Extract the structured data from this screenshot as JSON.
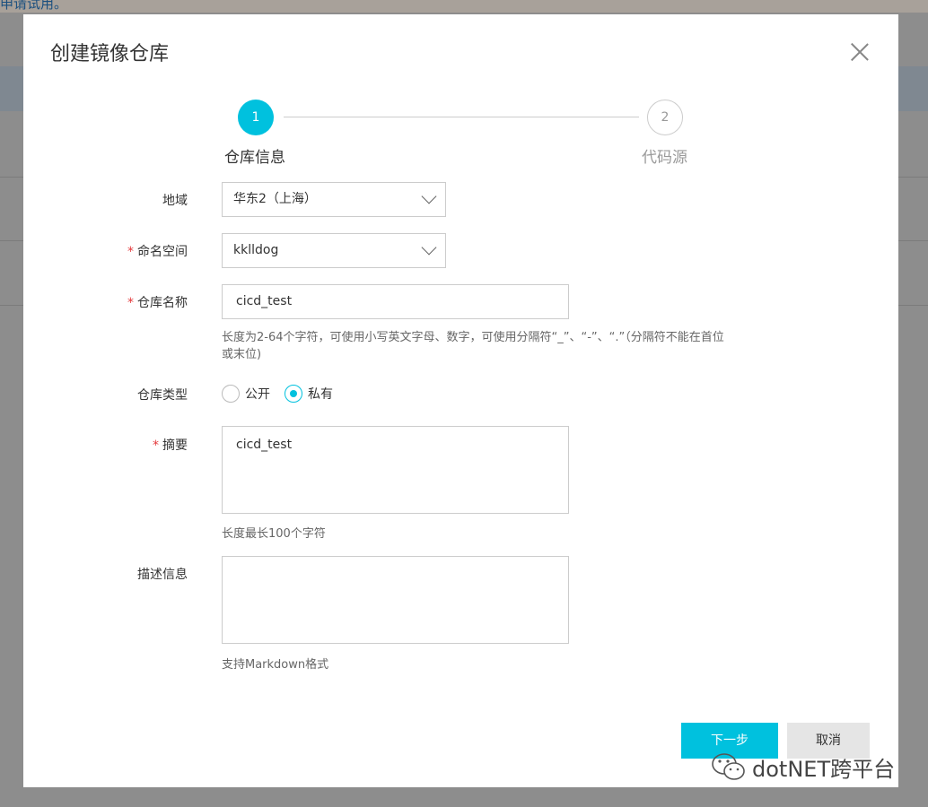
{
  "background": {
    "link_text": "申请试用。"
  },
  "dialog": {
    "title": "创建镜像仓库",
    "steps": [
      {
        "number": "1",
        "label": "仓库信息",
        "active": true
      },
      {
        "number": "2",
        "label": "代码源",
        "active": false
      }
    ],
    "fields": {
      "region": {
        "label": "地域",
        "value": "华东2（上海）"
      },
      "namespace": {
        "required_mark": "*",
        "label": "命名空间",
        "value": "kklldog"
      },
      "repo_name": {
        "required_mark": "*",
        "label": "仓库名称",
        "value": "cicd_test",
        "hint_line1": "长度为2-64个字符，可使用小写英文字母、数字，可使用分隔符“_”、“-”、“.”（分隔符不能在首位",
        "hint_line2": "或末位)"
      },
      "repo_type": {
        "label": "仓库类型",
        "options": [
          {
            "label": "公开",
            "checked": false
          },
          {
            "label": "私有",
            "checked": true
          }
        ]
      },
      "summary": {
        "required_mark": "*",
        "label": "摘要",
        "value": "cicd_test",
        "hint": "长度最长100个字符"
      },
      "description": {
        "label": "描述信息",
        "value": "",
        "hint": "支持Markdown格式"
      }
    },
    "buttons": {
      "next": "下一步",
      "cancel": "取消"
    },
    "accent_color": "#00c1de"
  },
  "watermark": {
    "text": "dotNET跨平台",
    "icon": "wechat-icon"
  }
}
